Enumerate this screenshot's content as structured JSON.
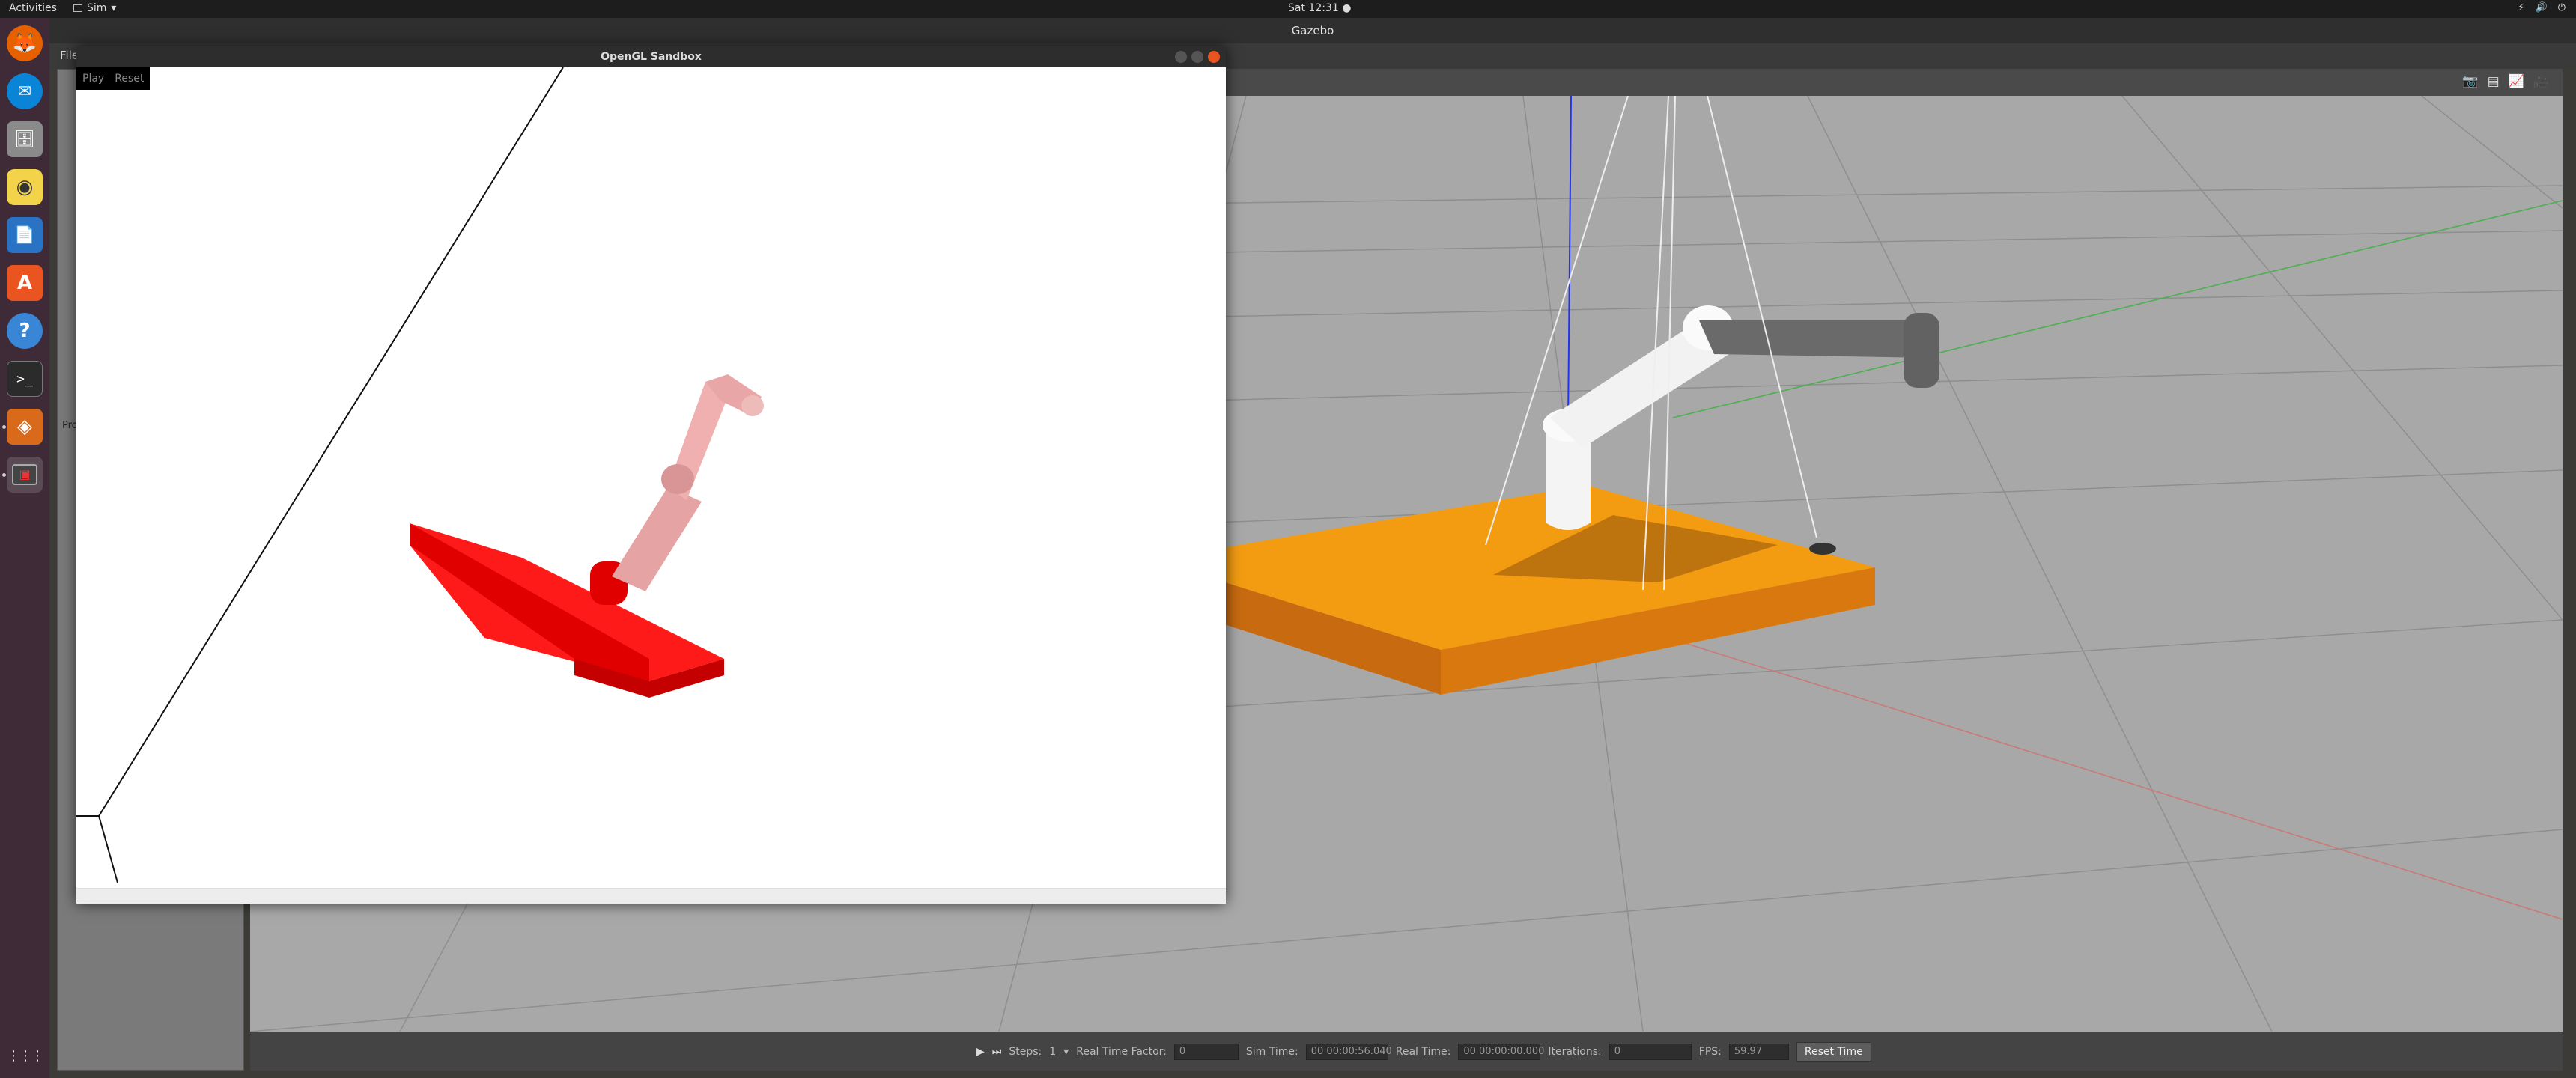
{
  "topbar": {
    "activities": "Activities",
    "app_menu": "Sim",
    "clock": "Sat 12:31 ●",
    "tray": [
      "⚡",
      "🔊",
      "⏻"
    ]
  },
  "dock": {
    "items": [
      {
        "name": "Firefox",
        "glyph": "🦊"
      },
      {
        "name": "Thunderbird",
        "glyph": "✉"
      },
      {
        "name": "Files",
        "glyph": "🗄"
      },
      {
        "name": "Rhythmbox",
        "glyph": "◉"
      },
      {
        "name": "LibreOffice Writer",
        "glyph": "📄"
      },
      {
        "name": "Ubuntu Software",
        "glyph": "A"
      },
      {
        "name": "Help",
        "glyph": "?"
      },
      {
        "name": "Terminal",
        "glyph": ">_"
      },
      {
        "name": "Gazebo",
        "glyph": "◈"
      },
      {
        "name": "OpenGL Sandbox",
        "glyph": "▣"
      }
    ],
    "show_apps": "⋮⋮⋮"
  },
  "gazebo": {
    "title": "Gazebo",
    "menu": "File",
    "left_panel_label": "Pro",
    "toolbar_icons": [
      "camera-icon",
      "log-icon",
      "plot-icon",
      "video-icon"
    ],
    "bottom": {
      "play": "▶",
      "step": "⏭",
      "steps_label": "Steps:",
      "steps_value": "1",
      "rtf_label": "Real Time Factor:",
      "rtf_value": "0",
      "sim_time_label": "Sim Time:",
      "sim_time_value": "00 00:00:56.040",
      "real_time_label": "Real Time:",
      "real_time_value": "00 00:00:00.000",
      "iterations_label": "Iterations:",
      "iterations_value": "0",
      "fps_label": "FPS:",
      "fps_value": "59.97",
      "reset_time": "Reset Time"
    },
    "colors": {
      "platform": "#f39c12",
      "platform_side": "#c06c0b",
      "arm_white": "#f4f4f4",
      "arm_gray": "#6a6a6a"
    }
  },
  "sandbox": {
    "title": "OpenGL Sandbox",
    "buttons": {
      "play": "Play",
      "reset": "Reset"
    },
    "colors": {
      "base": "#ff0000",
      "arm": "#e8a0a0"
    }
  }
}
